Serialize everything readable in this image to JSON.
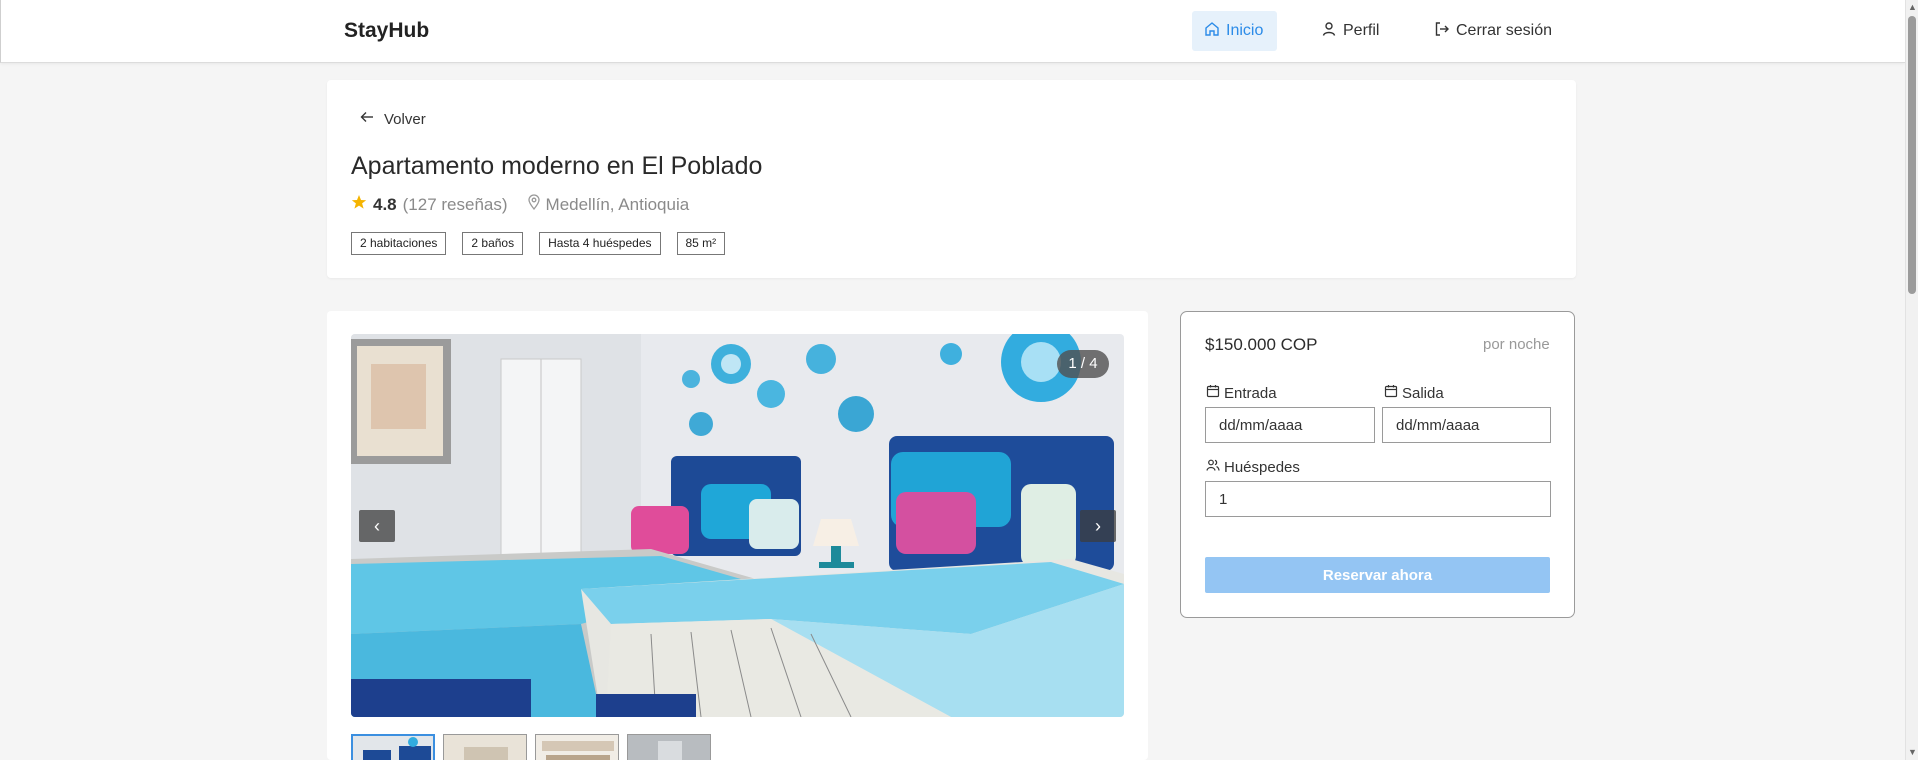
{
  "app": {
    "brand": "StayHub"
  },
  "nav": {
    "items": [
      {
        "label": "Inicio",
        "icon": "home-icon",
        "active": true
      },
      {
        "label": "Perfil",
        "icon": "user-icon",
        "active": false
      },
      {
        "label": "Cerrar sesión",
        "icon": "logout-icon",
        "active": false
      }
    ]
  },
  "listing": {
    "back_label": "Volver",
    "title": "Apartamento moderno en El Poblado",
    "rating": "4.8",
    "reviews": "(127 reseñas)",
    "location": "Medellín, Antioquia",
    "tags": [
      "2 habitaciones",
      "2 baños",
      "Hasta 4 huéspedes",
      "85 m²"
    ]
  },
  "gallery": {
    "counter": "1 / 4",
    "prev_symbol": "‹",
    "next_symbol": "›",
    "thumbnail_count": 4,
    "active_index": 0
  },
  "booking": {
    "price": "$150.000 COP",
    "per_night": "por noche",
    "checkin_label": "Entrada",
    "checkin_placeholder": "dd/mm/aaaa",
    "checkout_label": "Salida",
    "checkout_placeholder": "dd/mm/aaaa",
    "guests_label": "Huéspedes",
    "guests_value": "1",
    "reserve_label": "Reservar ahora"
  },
  "colors": {
    "accent": "#2b8be8",
    "active_nav_bg": "#e6f1fb",
    "reserve_button": "#94c5f3",
    "star": "#f5b400"
  }
}
